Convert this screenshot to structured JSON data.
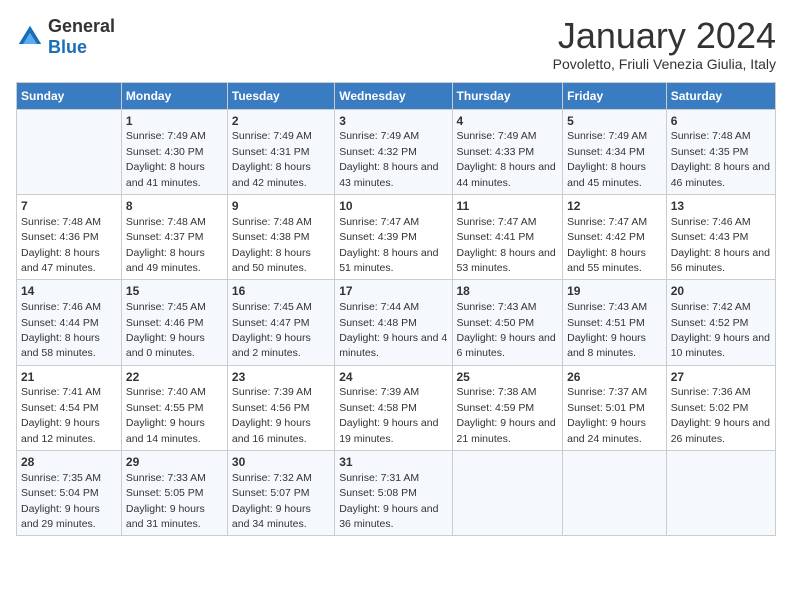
{
  "logo": {
    "general": "General",
    "blue": "Blue"
  },
  "title": "January 2024",
  "subtitle": "Povoletto, Friuli Venezia Giulia, Italy",
  "days": [
    "Sunday",
    "Monday",
    "Tuesday",
    "Wednesday",
    "Thursday",
    "Friday",
    "Saturday"
  ],
  "weeks": [
    [
      {
        "day": "",
        "sunrise": "",
        "sunset": "",
        "daylight": ""
      },
      {
        "day": "1",
        "sunrise": "Sunrise: 7:49 AM",
        "sunset": "Sunset: 4:30 PM",
        "daylight": "Daylight: 8 hours and 41 minutes."
      },
      {
        "day": "2",
        "sunrise": "Sunrise: 7:49 AM",
        "sunset": "Sunset: 4:31 PM",
        "daylight": "Daylight: 8 hours and 42 minutes."
      },
      {
        "day": "3",
        "sunrise": "Sunrise: 7:49 AM",
        "sunset": "Sunset: 4:32 PM",
        "daylight": "Daylight: 8 hours and 43 minutes."
      },
      {
        "day": "4",
        "sunrise": "Sunrise: 7:49 AM",
        "sunset": "Sunset: 4:33 PM",
        "daylight": "Daylight: 8 hours and 44 minutes."
      },
      {
        "day": "5",
        "sunrise": "Sunrise: 7:49 AM",
        "sunset": "Sunset: 4:34 PM",
        "daylight": "Daylight: 8 hours and 45 minutes."
      },
      {
        "day": "6",
        "sunrise": "Sunrise: 7:48 AM",
        "sunset": "Sunset: 4:35 PM",
        "daylight": "Daylight: 8 hours and 46 minutes."
      }
    ],
    [
      {
        "day": "7",
        "sunrise": "Sunrise: 7:48 AM",
        "sunset": "Sunset: 4:36 PM",
        "daylight": "Daylight: 8 hours and 47 minutes."
      },
      {
        "day": "8",
        "sunrise": "Sunrise: 7:48 AM",
        "sunset": "Sunset: 4:37 PM",
        "daylight": "Daylight: 8 hours and 49 minutes."
      },
      {
        "day": "9",
        "sunrise": "Sunrise: 7:48 AM",
        "sunset": "Sunset: 4:38 PM",
        "daylight": "Daylight: 8 hours and 50 minutes."
      },
      {
        "day": "10",
        "sunrise": "Sunrise: 7:47 AM",
        "sunset": "Sunset: 4:39 PM",
        "daylight": "Daylight: 8 hours and 51 minutes."
      },
      {
        "day": "11",
        "sunrise": "Sunrise: 7:47 AM",
        "sunset": "Sunset: 4:41 PM",
        "daylight": "Daylight: 8 hours and 53 minutes."
      },
      {
        "day": "12",
        "sunrise": "Sunrise: 7:47 AM",
        "sunset": "Sunset: 4:42 PM",
        "daylight": "Daylight: 8 hours and 55 minutes."
      },
      {
        "day": "13",
        "sunrise": "Sunrise: 7:46 AM",
        "sunset": "Sunset: 4:43 PM",
        "daylight": "Daylight: 8 hours and 56 minutes."
      }
    ],
    [
      {
        "day": "14",
        "sunrise": "Sunrise: 7:46 AM",
        "sunset": "Sunset: 4:44 PM",
        "daylight": "Daylight: 8 hours and 58 minutes."
      },
      {
        "day": "15",
        "sunrise": "Sunrise: 7:45 AM",
        "sunset": "Sunset: 4:46 PM",
        "daylight": "Daylight: 9 hours and 0 minutes."
      },
      {
        "day": "16",
        "sunrise": "Sunrise: 7:45 AM",
        "sunset": "Sunset: 4:47 PM",
        "daylight": "Daylight: 9 hours and 2 minutes."
      },
      {
        "day": "17",
        "sunrise": "Sunrise: 7:44 AM",
        "sunset": "Sunset: 4:48 PM",
        "daylight": "Daylight: 9 hours and 4 minutes."
      },
      {
        "day": "18",
        "sunrise": "Sunrise: 7:43 AM",
        "sunset": "Sunset: 4:50 PM",
        "daylight": "Daylight: 9 hours and 6 minutes."
      },
      {
        "day": "19",
        "sunrise": "Sunrise: 7:43 AM",
        "sunset": "Sunset: 4:51 PM",
        "daylight": "Daylight: 9 hours and 8 minutes."
      },
      {
        "day": "20",
        "sunrise": "Sunrise: 7:42 AM",
        "sunset": "Sunset: 4:52 PM",
        "daylight": "Daylight: 9 hours and 10 minutes."
      }
    ],
    [
      {
        "day": "21",
        "sunrise": "Sunrise: 7:41 AM",
        "sunset": "Sunset: 4:54 PM",
        "daylight": "Daylight: 9 hours and 12 minutes."
      },
      {
        "day": "22",
        "sunrise": "Sunrise: 7:40 AM",
        "sunset": "Sunset: 4:55 PM",
        "daylight": "Daylight: 9 hours and 14 minutes."
      },
      {
        "day": "23",
        "sunrise": "Sunrise: 7:39 AM",
        "sunset": "Sunset: 4:56 PM",
        "daylight": "Daylight: 9 hours and 16 minutes."
      },
      {
        "day": "24",
        "sunrise": "Sunrise: 7:39 AM",
        "sunset": "Sunset: 4:58 PM",
        "daylight": "Daylight: 9 hours and 19 minutes."
      },
      {
        "day": "25",
        "sunrise": "Sunrise: 7:38 AM",
        "sunset": "Sunset: 4:59 PM",
        "daylight": "Daylight: 9 hours and 21 minutes."
      },
      {
        "day": "26",
        "sunrise": "Sunrise: 7:37 AM",
        "sunset": "Sunset: 5:01 PM",
        "daylight": "Daylight: 9 hours and 24 minutes."
      },
      {
        "day": "27",
        "sunrise": "Sunrise: 7:36 AM",
        "sunset": "Sunset: 5:02 PM",
        "daylight": "Daylight: 9 hours and 26 minutes."
      }
    ],
    [
      {
        "day": "28",
        "sunrise": "Sunrise: 7:35 AM",
        "sunset": "Sunset: 5:04 PM",
        "daylight": "Daylight: 9 hours and 29 minutes."
      },
      {
        "day": "29",
        "sunrise": "Sunrise: 7:33 AM",
        "sunset": "Sunset: 5:05 PM",
        "daylight": "Daylight: 9 hours and 31 minutes."
      },
      {
        "day": "30",
        "sunrise": "Sunrise: 7:32 AM",
        "sunset": "Sunset: 5:07 PM",
        "daylight": "Daylight: 9 hours and 34 minutes."
      },
      {
        "day": "31",
        "sunrise": "Sunrise: 7:31 AM",
        "sunset": "Sunset: 5:08 PM",
        "daylight": "Daylight: 9 hours and 36 minutes."
      },
      {
        "day": "",
        "sunrise": "",
        "sunset": "",
        "daylight": ""
      },
      {
        "day": "",
        "sunrise": "",
        "sunset": "",
        "daylight": ""
      },
      {
        "day": "",
        "sunrise": "",
        "sunset": "",
        "daylight": ""
      }
    ]
  ]
}
